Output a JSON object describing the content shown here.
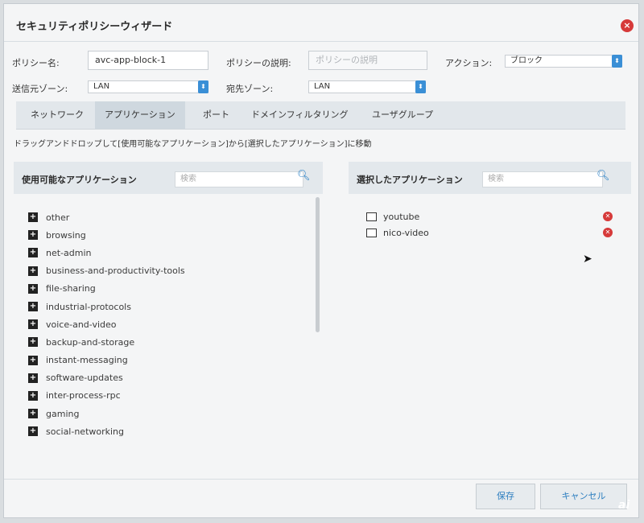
{
  "window": {
    "title": "セキュリティポリシーウィザード",
    "close_icon": "×"
  },
  "form": {
    "policy_name_label": "ポリシー名:",
    "policy_name_value": "avc-app-block-1",
    "description_label": "ポリシーの説明:",
    "description_placeholder": "ポリシーの説明",
    "action_label": "アクション:",
    "action_value": "ブロック",
    "source_zone_label": "送信元ゾーン:",
    "source_zone_value": "LAN",
    "dest_zone_label": "宛先ゾーン:",
    "dest_zone_value": "LAN"
  },
  "tabs": [
    {
      "label": "ネットワーク"
    },
    {
      "label": "アプリケーション"
    },
    {
      "label": "ポート"
    },
    {
      "label": "ドメインフィルタリング"
    },
    {
      "label": "ユーザグループ"
    }
  ],
  "instruction": "ドラッグアンドドロップして[使用可能なアプリケーション]から[選択したアプリケーション]に移動",
  "available": {
    "title": "使用可能なアプリケーション",
    "search_placeholder": "検索",
    "items": [
      {
        "label": "other"
      },
      {
        "label": "browsing"
      },
      {
        "label": "net-admin"
      },
      {
        "label": "business-and-productivity-tools"
      },
      {
        "label": "file-sharing"
      },
      {
        "label": "industrial-protocols"
      },
      {
        "label": "voice-and-video"
      },
      {
        "label": "backup-and-storage"
      },
      {
        "label": "instant-messaging"
      },
      {
        "label": "software-updates"
      },
      {
        "label": "inter-process-rpc"
      },
      {
        "label": "gaming"
      },
      {
        "label": "social-networking"
      }
    ]
  },
  "selected": {
    "title": "選択したアプリケーション",
    "search_placeholder": "検索",
    "items": [
      {
        "label": "youtube"
      },
      {
        "label": "nico-video"
      }
    ]
  },
  "footer": {
    "save_label": "保存",
    "cancel_label": "キャンセル"
  },
  "watermark": "ai",
  "colors": {
    "accent": "#2e7fc0",
    "danger": "#d63a3a"
  }
}
